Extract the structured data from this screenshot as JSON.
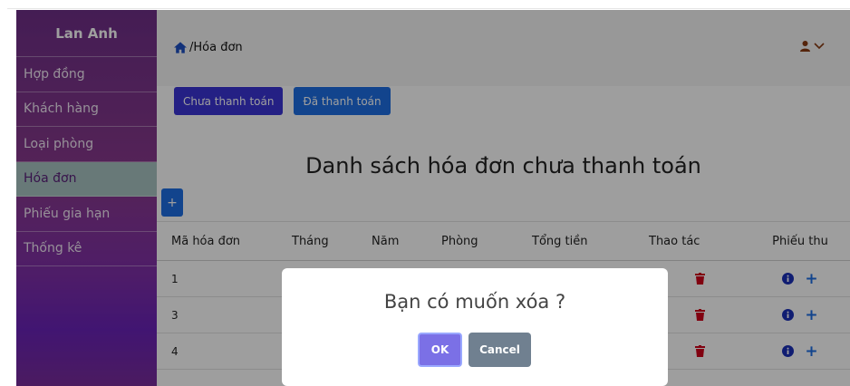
{
  "sidebar": {
    "brand": "Lan Anh",
    "items": [
      {
        "label": "Hợp đồng"
      },
      {
        "label": "Khách hàng"
      },
      {
        "label": "Loại phòng"
      },
      {
        "label": "Hóa đơn"
      },
      {
        "label": "Phiếu gia hạn"
      },
      {
        "label": "Thống kê"
      }
    ]
  },
  "header": {
    "home_icon": "home-icon",
    "breadcrumb": "/Hóa đơn",
    "user_icon": "user-icon",
    "chevron_icon": "chevron-down-icon"
  },
  "filters": {
    "unpaid_label": "Chưa thanh toán",
    "paid_label": "Đã thanh toán"
  },
  "page_title": "Danh sách hóa đơn chưa thanh toán",
  "add_button": "+",
  "table": {
    "columns": [
      "Mã hóa đơn",
      "Tháng",
      "Năm",
      "Phòng",
      "Tổng tiền",
      "Thao tác",
      "Phiếu thu"
    ],
    "rows": [
      {
        "id": "1"
      },
      {
        "id": "3"
      },
      {
        "id": "4"
      }
    ],
    "row_icons": {
      "delete": "trash-icon",
      "info": "info-icon",
      "add": "+"
    }
  },
  "modal": {
    "question": "Bạn có muốn xóa ?",
    "ok_label": "OK",
    "cancel_label": "Cancel"
  },
  "colors": {
    "accent": "#1d6fe4",
    "primary_dark": "#3a34d6",
    "delete_red": "#d0021b",
    "user_icon": "#8a3b12"
  }
}
